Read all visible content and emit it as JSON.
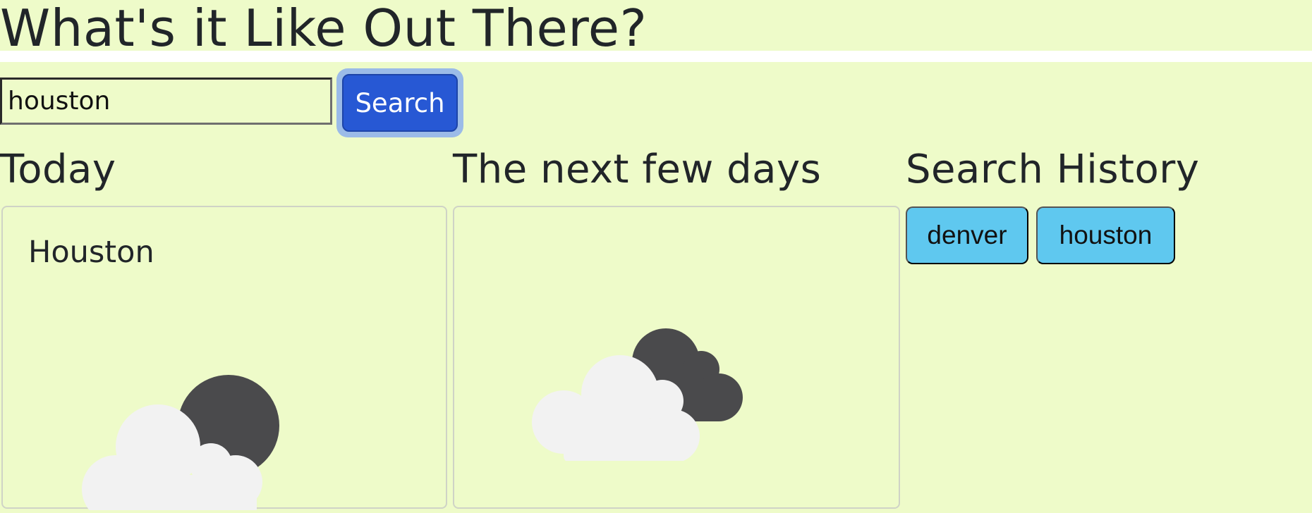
{
  "header": {
    "title": "What's it Like Out There?"
  },
  "search": {
    "value": "houston",
    "button_label": "Search"
  },
  "today": {
    "heading": "Today",
    "city": "Houston",
    "icon": "night-partly-cloudy-icon"
  },
  "forecast": {
    "heading": "The next few days",
    "icon": "cloudy-icon"
  },
  "history": {
    "heading": "Search History",
    "items": [
      {
        "label": "denver"
      },
      {
        "label": "houston"
      }
    ]
  },
  "colors": {
    "page_background": "#eefbc9",
    "search_button": "#2758d4",
    "history_button": "#5fc8ef",
    "cloud_light": "#f2f2f2",
    "cloud_dark": "#4a4a4c"
  }
}
